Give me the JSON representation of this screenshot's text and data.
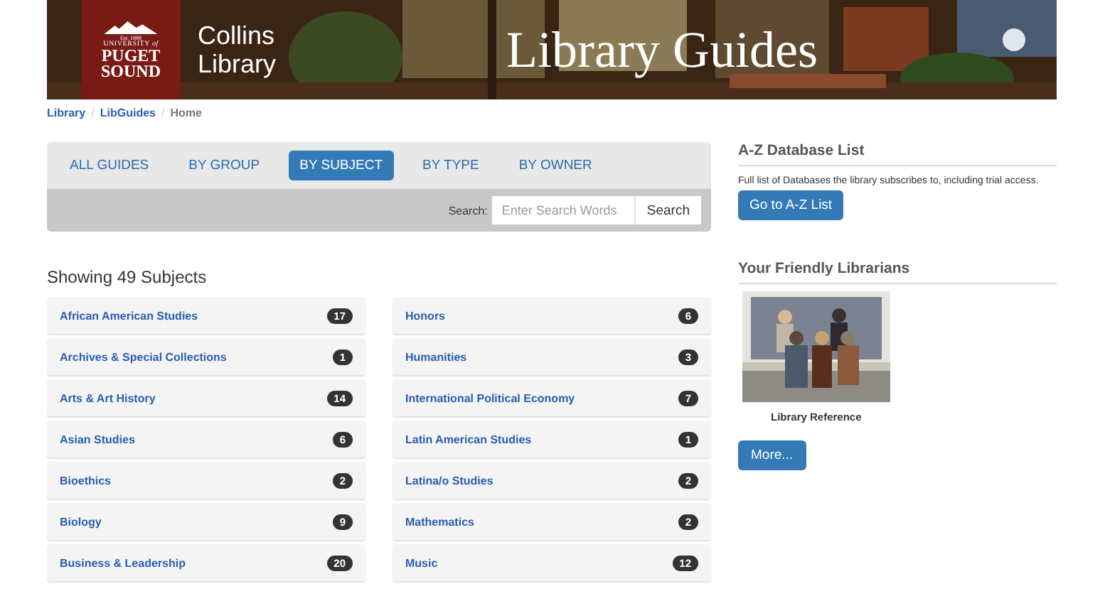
{
  "banner": {
    "logo": {
      "est": "Est. 1888",
      "university": "UNIVERSITY",
      "of": "of",
      "name_1": "PUGET",
      "name_2": "SOUND"
    },
    "library_name": [
      "Collins",
      "Library"
    ],
    "title": "Library Guides"
  },
  "breadcrumb": [
    {
      "label": "Library",
      "current": false
    },
    {
      "separator": "/",
      "label": "LibGuides",
      "current": false
    },
    {
      "separator": "/",
      "label": "Home",
      "current": true
    }
  ],
  "tabs": [
    {
      "label": "ALL GUIDES",
      "selected": false
    },
    {
      "label": "BY GROUP",
      "selected": false
    },
    {
      "label": "BY SUBJECT",
      "selected": true
    },
    {
      "label": "BY TYPE",
      "selected": false
    },
    {
      "label": "BY OWNER",
      "selected": false
    }
  ],
  "search": {
    "label": "Search:",
    "placeholder": "Enter Search Words",
    "button": "Search"
  },
  "heading": "Showing 49 Subjects",
  "subjects": [
    {
      "name": "African American Studies",
      "count": "17"
    },
    {
      "name": "Archives & Special Collections",
      "count": "1"
    },
    {
      "name": "Arts & Art History",
      "count": "14"
    },
    {
      "name": "Asian Studies",
      "count": "6"
    },
    {
      "name": "Bioethics",
      "count": "2"
    },
    {
      "name": "Biology",
      "count": "9"
    },
    {
      "name": "Business & Leadership",
      "count": "20"
    },
    {
      "name": "Honors",
      "count": "6"
    },
    {
      "name": "Humanities",
      "count": "3"
    },
    {
      "name": "International Political Economy",
      "count": "7"
    },
    {
      "name": "Latin American Studies",
      "count": "1"
    },
    {
      "name": "Latina/o Studies",
      "count": "2"
    },
    {
      "name": "Mathematics",
      "count": "2"
    },
    {
      "name": "Music",
      "count": "12"
    }
  ],
  "az": {
    "title": "A-Z Database List",
    "text": "Full list of Databases the library subscribes to, including trial access.",
    "button": "Go to A-Z List"
  },
  "librarians": {
    "title": "Your Friendly Librarians",
    "caption": "Library Reference",
    "button": "More..."
  }
}
